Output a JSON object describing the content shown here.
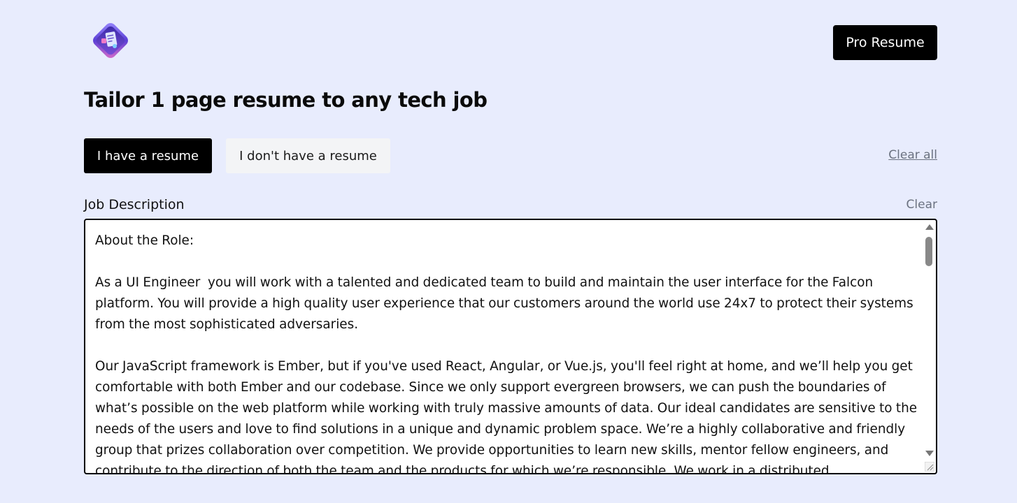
{
  "header": {
    "logo_icon": "resume-diamond-logo-icon",
    "pro_button_label": "Pro Resume"
  },
  "page_title": "Tailor 1 page resume to any tech job",
  "tabs": [
    {
      "label": "I have a resume",
      "active": true
    },
    {
      "label": "I don't have a resume",
      "active": false
    }
  ],
  "clear_all_label": "Clear all",
  "job_description": {
    "label": "Job Description",
    "clear_label": "Clear",
    "text": "About the Role:\n\nAs a UI Engineer  you will work with a talented and dedicated team to build and maintain the user interface for the Falcon platform. You will provide a high quality user experience that our customers around the world use 24x7 to protect their systems from the most sophisticated adversaries.\n\nOur JavaScript framework is Ember, but if you've used React, Angular, or Vue.js, you'll feel right at home, and we’ll help you get comfortable with both Ember and our codebase. Since we only support evergreen browsers, we can push the boundaries of what’s possible on the web platform while working with truly massive amounts of data. Our ideal candidates are sensitive to the needs of the users and love to find solutions in a unique and dynamic problem space. We’re a highly collaborative and friendly group that prizes collaboration over competition. We provide opportunities to learn new skills, mentor fellow engineers, and contribute to the direction of both the team and the products for which we’re responsible. We work in a distributed"
  },
  "colors": {
    "background": "#e8ecfd",
    "primary": "#000000",
    "inactive_tab": "#f3f4f6",
    "muted_text": "#6b7280"
  }
}
